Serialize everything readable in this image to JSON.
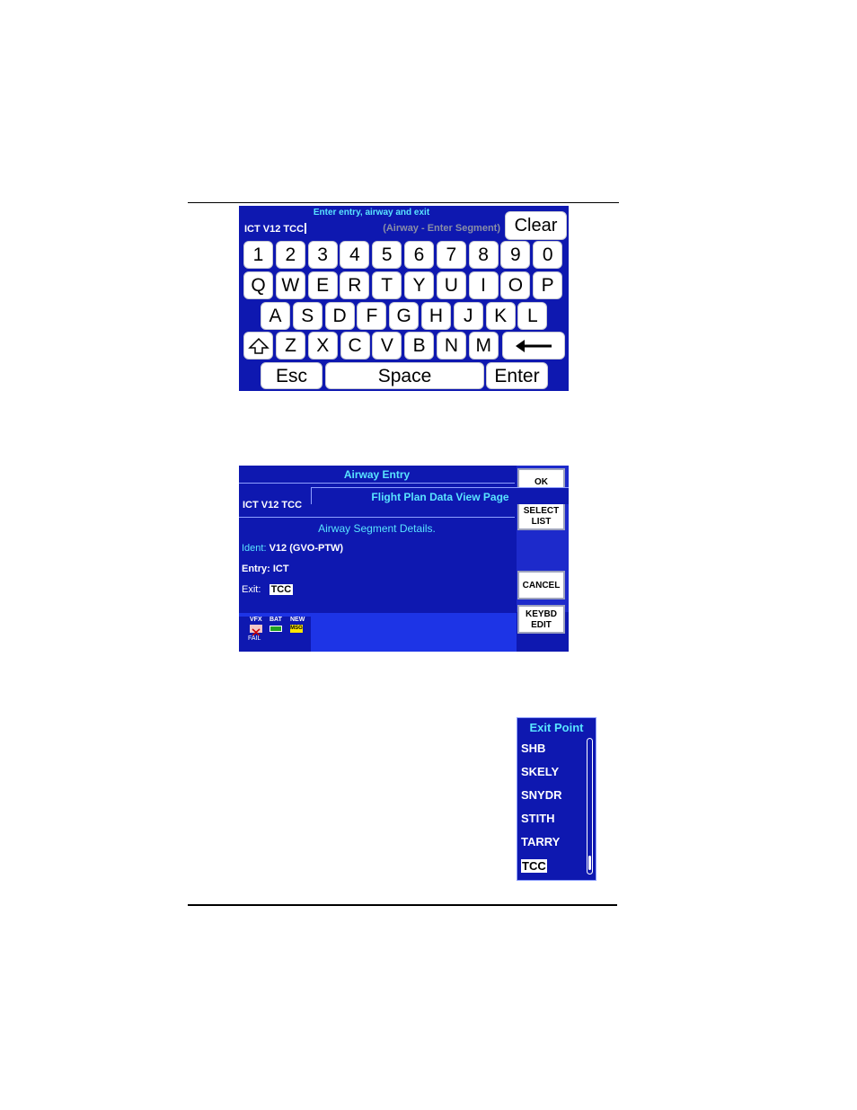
{
  "keyboard": {
    "title": "Enter entry, airway and exit",
    "entry_value": "ICT V12 TCC",
    "entry_hint": "(Airway - Enter Segment)",
    "clear_label": "Clear",
    "row_numbers": [
      "1",
      "2",
      "3",
      "4",
      "5",
      "6",
      "7",
      "8",
      "9",
      "0"
    ],
    "row_q": [
      "Q",
      "W",
      "E",
      "R",
      "T",
      "Y",
      "U",
      "I",
      "O",
      "P"
    ],
    "row_a": [
      "A",
      "S",
      "D",
      "F",
      "G",
      "H",
      "J",
      "K",
      "L"
    ],
    "row_z": [
      "Z",
      "X",
      "C",
      "V",
      "B",
      "N",
      "M"
    ],
    "shift_icon": "shift-icon",
    "backspace_icon": "backspace-arrow-icon",
    "esc_label": "Esc",
    "space_label": "Space",
    "enter_label": "Enter"
  },
  "airway": {
    "header": "Airway Entry",
    "entry_text": "ICT V12 TCC",
    "details_title": "Airway Segment Details.",
    "ident_label": "Ident:",
    "ident_value": "V12 (GVO-PTW)",
    "entry_label": "Entry:",
    "entry_value": "ICT",
    "exit_label": "Exit:",
    "exit_value": "TCC",
    "buttons": {
      "ok": "OK",
      "select_1": "SELECT",
      "select_2": "LIST",
      "cancel": "CANCEL",
      "keybd_1": "KEYBD",
      "keybd_2": "EDIT"
    },
    "status": {
      "vfx": "VFX",
      "bat": "BAT",
      "new": "NEW",
      "new_badge": "MSG",
      "fail": "FAIL"
    },
    "page_title": "Flight Plan Data View Page"
  },
  "exit_list": {
    "title": "Exit Point",
    "items": [
      "SHB",
      "SKELY",
      "SNYDR",
      "STITH",
      "TARRY",
      "TCC"
    ],
    "selected": "TCC"
  }
}
